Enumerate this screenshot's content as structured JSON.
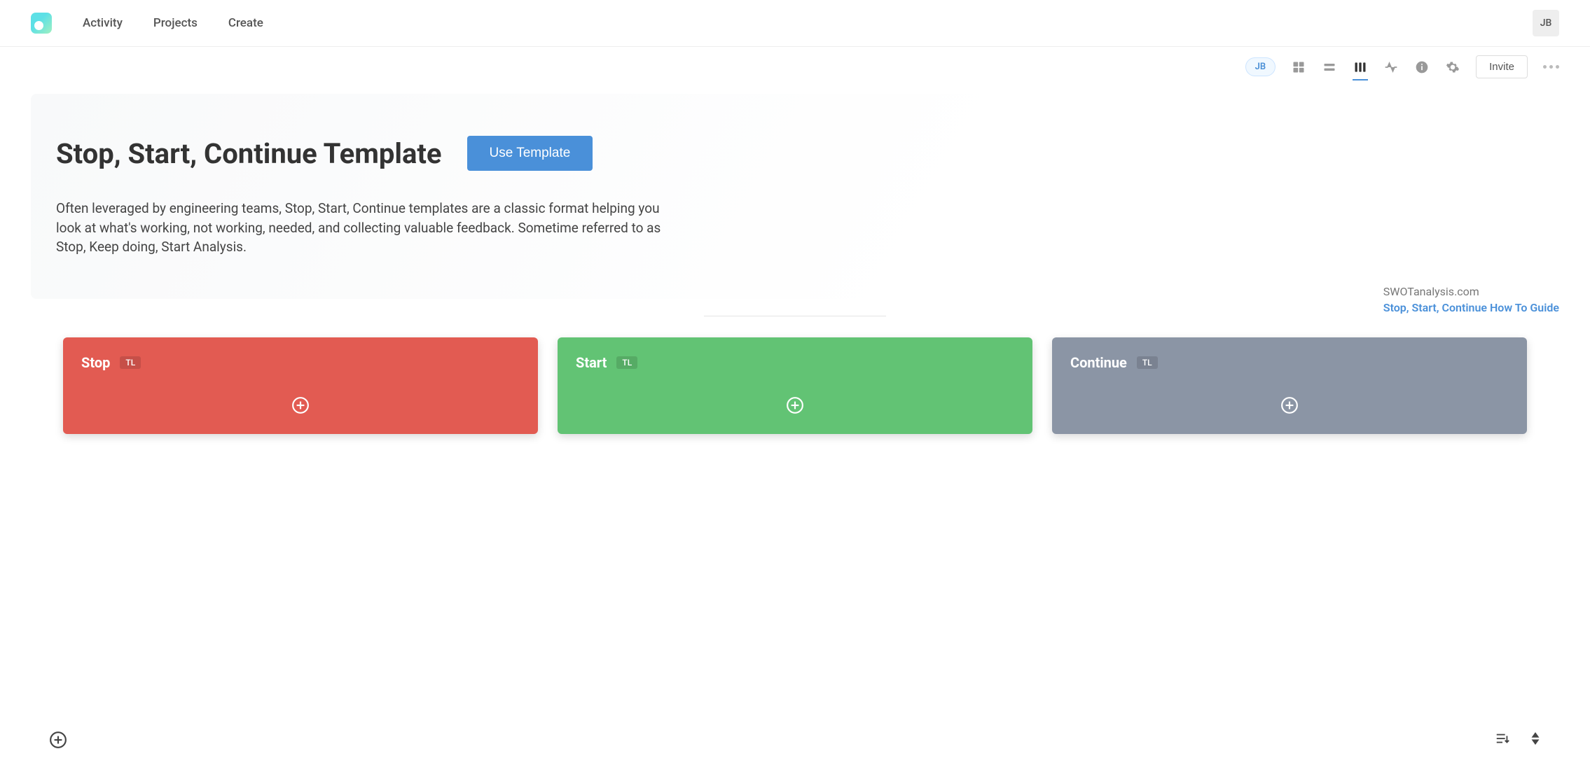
{
  "nav": {
    "items": [
      "Activity",
      "Projects",
      "Create"
    ],
    "user_initials": "JB"
  },
  "toolbar": {
    "user_initials": "JB",
    "invite_label": "Invite"
  },
  "hero": {
    "title": "Stop, Start, Continue Template",
    "use_button": "Use Template",
    "description": "Often leveraged by engineering teams, Stop, Start, Continue templates are a classic format helping you look at what's working, not working, needed, and collecting valuable feedback. Sometime referred to as Stop, Keep doing, Start Analysis."
  },
  "side": {
    "source": "SWOTanalysis.com",
    "guide_link": "Stop, Start, Continue How To Guide"
  },
  "columns": [
    {
      "title": "Stop",
      "tag": "TL",
      "color": "red"
    },
    {
      "title": "Start",
      "tag": "TL",
      "color": "green"
    },
    {
      "title": "Continue",
      "tag": "TL",
      "color": "gray"
    }
  ]
}
